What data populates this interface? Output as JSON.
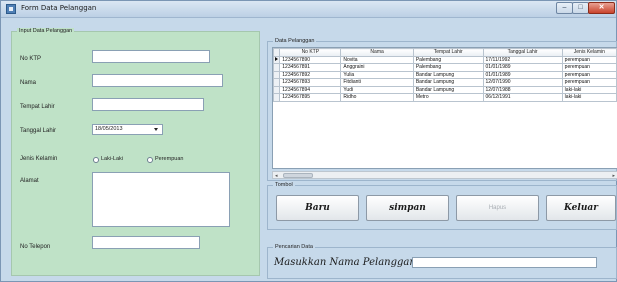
{
  "window": {
    "title": "Form Data Pelanggan",
    "minimize_glyph": "–",
    "maximize_glyph": "□",
    "close_glyph": "✕"
  },
  "input_group": {
    "caption": "Input Data Pelanggan",
    "fields": {
      "no_ktp": {
        "label": "No KTP",
        "value": ""
      },
      "nama": {
        "label": "Nama",
        "value": ""
      },
      "tempat_lahir": {
        "label": "Tempat Lahir",
        "value": ""
      },
      "tanggal_lahir": {
        "label": "Tanggal Lahir",
        "value": "18/05/2013"
      },
      "jenis_kelamin": {
        "label": "Jenis Kelamin",
        "options": [
          "Laki-Laki",
          "Perempuan"
        ],
        "selected": null
      },
      "alamat": {
        "label": "Alamat",
        "value": ""
      },
      "no_telepon": {
        "label": "No Telepon",
        "value": ""
      }
    }
  },
  "data_group": {
    "caption": "Data Pelanggan",
    "columns": [
      "No KTP",
      "Nama",
      "Tempat Lahir",
      "Tanggal Lahir",
      "Jenis Kelamin"
    ],
    "rows": [
      [
        "1234567890",
        "Novita",
        "Palembang",
        "17/11/1992",
        "perempuan"
      ],
      [
        "1234567891",
        "Anggraini",
        "Palembang",
        "01/01/1989",
        "perempuan"
      ],
      [
        "1234567892",
        "Yulia",
        "Bandar Lampung",
        "01/01/1989",
        "perempuan"
      ],
      [
        "1234567893",
        "Fitdianti",
        "Bandar Lampung",
        "12/07/1990",
        "perempuan"
      ],
      [
        "1234567894",
        "Yudi",
        "Bandar Lampung",
        "12/07/1988",
        "laki-laki"
      ],
      [
        "1234567895",
        "Ridho",
        "Metro",
        "06/12/1991",
        "laki-laki"
      ]
    ],
    "selected_row": 0
  },
  "tombol_group": {
    "caption": "Tombol",
    "buttons": {
      "baru": "Baru",
      "simpan": "simpan",
      "hapus": "Hapus",
      "keluar": "Keluar"
    }
  },
  "search_group": {
    "caption": "Pencarian Data",
    "label": "Masukkan Nama Pelanggan",
    "value": ""
  },
  "colors": {
    "window_frame": "#c6d9ea",
    "input_panel": "#bfe2c7",
    "close_button": "#c9432c"
  }
}
